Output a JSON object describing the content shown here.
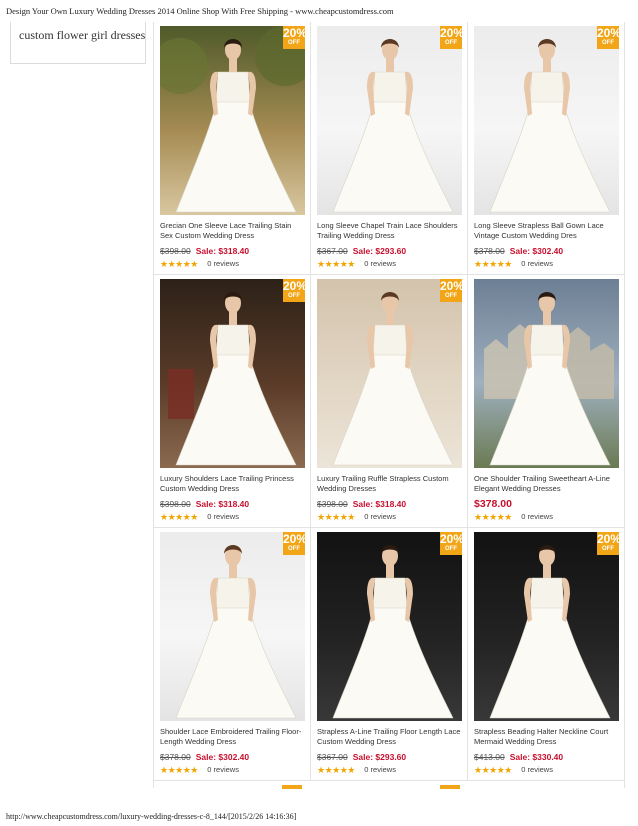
{
  "page_title": "Design Your Own Luxury Wedding Dresses 2014 Online Shop With Free Shipping - www.cheapcustomdress.com",
  "footer_url": "http://www.cheapcustomdress.com/luxury-wedding-dresses-c-8_144/[2015/2/26 14:16:36]",
  "sidebar": {
    "link": "custom flower girl dresses"
  },
  "colors": {
    "badge": "#f2a516",
    "sale": "#c8102e",
    "stars": "#f0a500",
    "border": "#e3e3e3"
  },
  "badge": {
    "percent": "20%",
    "off": "OFF"
  },
  "rating": {
    "stars": "★★★★★",
    "reviews": "0 reviews"
  },
  "products": [
    {
      "title": "Grecian One Sleeve Lace Trailing Stain Sex Custom Wedding Dress",
      "old_price": "$398.00",
      "sale_price": "Sale: $318.40",
      "badge": true,
      "background": "park"
    },
    {
      "title": "Long Sleeve Chapel Train Lace Shoulders Trailing Wedding Dress",
      "old_price": "$367.00",
      "sale_price": "Sale: $293.60",
      "badge": true,
      "background": "studio"
    },
    {
      "title": "Long Sleeve Strapless Ball Gown Lace Vintage Custom Wedding Dres",
      "old_price": "$378.00",
      "sale_price": "Sale: $302.40",
      "badge": true,
      "background": "studio"
    },
    {
      "title": "Luxury Shoulders Lace Trailing Princess Custom Wedding Dress",
      "old_price": "$398.00",
      "sale_price": "Sale: $318.40",
      "badge": true,
      "background": "dark"
    },
    {
      "title": "Luxury Trailing Ruffle Strapless Custom Wedding Dresses",
      "old_price": "$398.00",
      "sale_price": "Sale: $318.40",
      "badge": true,
      "background": "beige"
    },
    {
      "title": "One Shoulder Trailing Sweetheart A-Line Elegant Wedding Dresses",
      "price": "$378.00",
      "badge": false,
      "background": "castle"
    },
    {
      "title": "Shoulder Lace Embroidered Trailing Floor-Length Wedding Dress",
      "old_price": "$378.00",
      "sale_price": "Sale: $302.40",
      "badge": true,
      "background": "studio"
    },
    {
      "title": "Strapless A-Line Trailing Floor Length Lace Custom Wedding Dress",
      "old_price": "$367.00",
      "sale_price": "Sale: $293.60",
      "badge": true,
      "background": "black"
    },
    {
      "title": "Strapless Beading Halter Neckline Court Mermaid Wedding Dress",
      "old_price": "$413.00",
      "sale_price": "Sale: $330.40",
      "badge": true,
      "background": "black"
    }
  ]
}
